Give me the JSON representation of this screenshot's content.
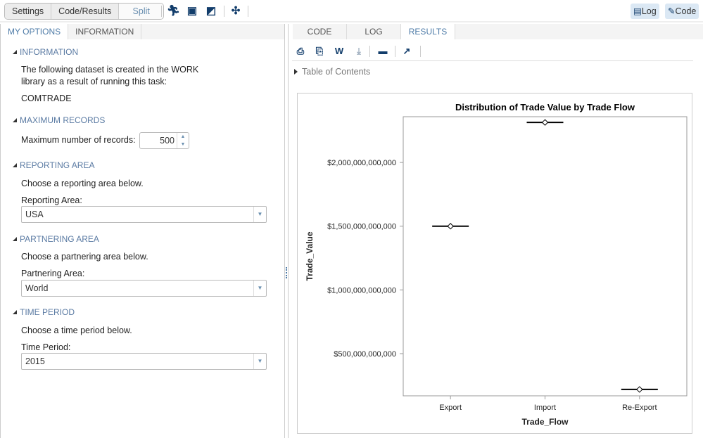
{
  "toolbar": {
    "segments": [
      "Settings",
      "Code/Results",
      "Split"
    ],
    "log_label": "Log",
    "code_label": "Code"
  },
  "left": {
    "tabs": [
      "MY OPTIONS",
      "INFORMATION"
    ],
    "sections": {
      "information": {
        "title": "INFORMATION",
        "text1": "The following dataset is created in the WORK",
        "text2": "library as a result of running this task:",
        "dataset": "COMTRADE"
      },
      "max_records": {
        "title": "MAXIMUM RECORDS",
        "label": "Maximum number of records:",
        "value": "500"
      },
      "reporting": {
        "title": "REPORTING AREA",
        "desc": "Choose a reporting area below.",
        "label": "Reporting Area:",
        "value": "USA"
      },
      "partnering": {
        "title": "PARTNERING AREA",
        "desc": "Choose a partnering area below.",
        "label": "Partnering Area:",
        "value": "World"
      },
      "time": {
        "title": "TIME PERIOD",
        "desc": "Choose a time period below.",
        "label": "Time Period:",
        "value": "2015"
      }
    }
  },
  "right": {
    "tabs": [
      "CODE",
      "LOG",
      "RESULTS"
    ],
    "toc": "Table of Contents"
  },
  "chart_data": {
    "type": "scatter",
    "title": "Distribution of Trade Value by Trade Flow",
    "xlabel": "Trade_Flow",
    "ylabel": "Trade_Value",
    "categories": [
      "Export",
      "Import",
      "Re-Export"
    ],
    "values": [
      1500000000000,
      2314000000000,
      219000000000
    ],
    "ylim": [
      169000000000,
      2359000000000
    ],
    "yticks": [
      500000000000,
      1000000000000,
      1500000000000,
      2000000000000
    ],
    "ytick_labels": [
      "$500,000,000,000",
      "$1,000,000,000,000",
      "$1,500,000,000,000",
      "$2,000,000,000,000"
    ],
    "grid": false
  }
}
